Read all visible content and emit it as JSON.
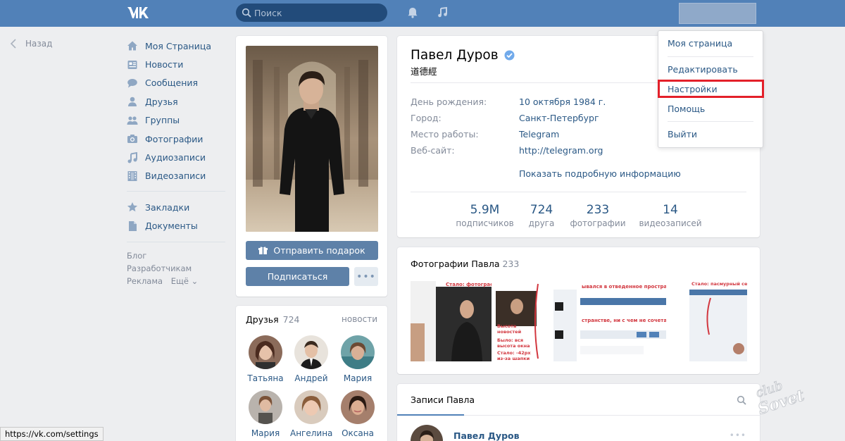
{
  "header": {
    "search_placeholder": "Поиск",
    "icons": [
      "vk-logo-icon",
      "search-icon",
      "bell-icon",
      "music-icon"
    ]
  },
  "back": {
    "label": "Назад"
  },
  "nav": {
    "items": [
      {
        "label": "Моя Страница",
        "icon": "home-icon"
      },
      {
        "label": "Новости",
        "icon": "news-icon"
      },
      {
        "label": "Сообщения",
        "icon": "messages-icon"
      },
      {
        "label": "Друзья",
        "icon": "friends-icon"
      },
      {
        "label": "Группы",
        "icon": "groups-icon"
      },
      {
        "label": "Фотографии",
        "icon": "camera-icon"
      },
      {
        "label": "Аудиозаписи",
        "icon": "music-note-icon"
      },
      {
        "label": "Видеозаписи",
        "icon": "film-icon"
      }
    ],
    "items2": [
      {
        "label": "Закладки",
        "icon": "star-icon"
      },
      {
        "label": "Документы",
        "icon": "document-icon"
      }
    ],
    "footer": {
      "blog": "Блог",
      "developers": "Разработчикам",
      "ads": "Реклама",
      "more": "Ещё ⌄"
    }
  },
  "profile": {
    "send_gift": "Отправить подарок",
    "subscribe": "Подписаться",
    "more": "•••"
  },
  "friends": {
    "title": "Друзья",
    "count": "724",
    "news": "новости",
    "list": [
      "Татьяна",
      "Андрей",
      "Мария",
      "Мария",
      "Ангелина",
      "Оксана"
    ]
  },
  "info": {
    "name": "Павел Дуров",
    "status": "道德經",
    "rows": [
      {
        "label": "День рождения:",
        "value": "10 октября 1984 г."
      },
      {
        "label": "Город:",
        "value": "Санкт-Петербург"
      },
      {
        "label": "Место работы:",
        "value": "Telegram"
      },
      {
        "label": "Веб-сайт:",
        "value": "http://telegram.org"
      }
    ],
    "more_info": "Показать подробную информацию",
    "stats": [
      {
        "num": "5.9M",
        "label": "подписчиков"
      },
      {
        "num": "724",
        "label": "друга"
      },
      {
        "num": "233",
        "label": "фотографии"
      },
      {
        "num": "14",
        "label": "видеозаписей"
      }
    ]
  },
  "photos": {
    "title": "Фотографии Павла",
    "count": "233",
    "captions": [
      "Стало: фотографи",
      "Высота новостей",
      "Было: вся высота окна",
      "Стало: -42px из-за шапки",
      "ывался в отведенное простран",
      "странстве, ни с чем не сочета",
      "Стало: пасмурный серый"
    ]
  },
  "posts": {
    "tab": "Записи Павла",
    "author": "Павел Дуров"
  },
  "dropdown": {
    "my_page": "Моя страница",
    "edit": "Редактировать",
    "settings": "Настройки",
    "help": "Помощь",
    "logout": "Выйти",
    "highlight_color": "#e3202a"
  },
  "statusbar": {
    "url": "https://vk.com/settings"
  },
  "watermark": {
    "text": "club Sovet"
  }
}
